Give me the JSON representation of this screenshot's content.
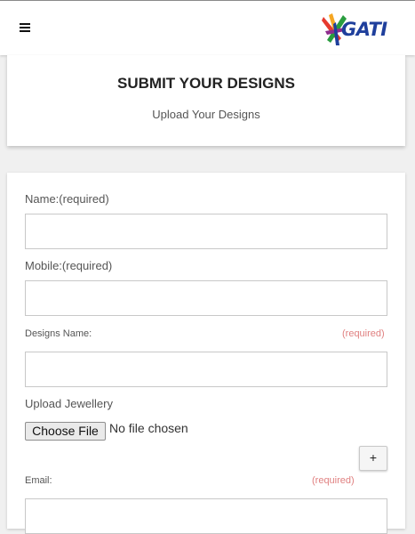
{
  "header": {
    "menu_icon": "hamburger-menu-icon",
    "logo_text": "GATI",
    "logo_colors": [
      "#e63a2e",
      "#f5a623",
      "#2a9d3f",
      "#1f3f9c",
      "#8e2c8e"
    ]
  },
  "intro": {
    "title": "SUBMIT YOUR DESIGNS",
    "subtitle": "Upload Your Designs"
  },
  "form": {
    "name_label": "Name:(required)",
    "name_value": "",
    "mobile_label": "Mobile:(required)",
    "mobile_value": "",
    "design_name_label": "Designs Name:",
    "design_name_required": "(required)",
    "design_name_value": "",
    "upload_label": "Upload Jewellery",
    "choose_file_label": "Choose File",
    "no_file_text": "No file chosen",
    "add_more_label": "+",
    "email_label": "Email:",
    "email_required": "(required)",
    "email_value": ""
  }
}
